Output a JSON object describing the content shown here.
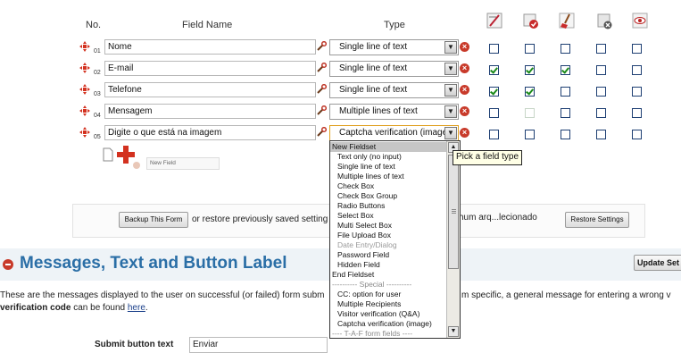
{
  "headers": {
    "no": "No.",
    "field_name": "Field Name",
    "type": "Type"
  },
  "rows": [
    {
      "num": "01",
      "name": "Nome",
      "type": "Single line of text",
      "checks": [
        false,
        false,
        false,
        false,
        false
      ],
      "disabled": [
        false,
        false,
        false,
        false,
        false
      ]
    },
    {
      "num": "02",
      "name": "E-mail",
      "type": "Single line of text",
      "checks": [
        true,
        true,
        true,
        false,
        false
      ],
      "disabled": [
        false,
        false,
        false,
        false,
        false
      ]
    },
    {
      "num": "03",
      "name": "Telefone",
      "type": "Single line of text",
      "checks": [
        true,
        true,
        false,
        false,
        false
      ],
      "disabled": [
        false,
        false,
        false,
        false,
        false
      ]
    },
    {
      "num": "04",
      "name": "Mensagem",
      "type": "Multiple lines of text",
      "checks": [
        false,
        false,
        false,
        false,
        false
      ],
      "disabled": [
        false,
        true,
        false,
        false,
        false
      ]
    },
    {
      "num": "05",
      "name": "Digite o que está na imagem",
      "type": "Captcha verification (image",
      "checks": [
        false,
        false,
        false,
        false,
        false
      ],
      "disabled": [
        false,
        false,
        false,
        false,
        false
      ]
    }
  ],
  "new_field_label": "New Field",
  "backup_button": "Backup This Form",
  "restore_text": "or restore previously saved setting",
  "file_field_text": "hum arq...lecionado",
  "restore_button": "Restore Settings",
  "section_title": "Messages, Text and Button Label",
  "update_button": "Update Set",
  "desc_line1_a": "These are the messages displayed to the user on successful (or failed) form subm",
  "desc_line1_b": "m specific, a general message for entering a wrong v",
  "desc_line2_bold": "verification code",
  "desc_line2_rest": " can be found ",
  "desc_link": "here",
  "desc_line2_end": ".",
  "submit_label": "Submit button text",
  "submit_value": "Enviar",
  "tooltip": "Pick a field type",
  "dropdown_items": [
    {
      "label": "New Fieldset",
      "style": "selected"
    },
    {
      "label": "Text only (no input)",
      "style": "indent"
    },
    {
      "label": "Single line of text",
      "style": "indent"
    },
    {
      "label": "Multiple lines of text",
      "style": "indent"
    },
    {
      "label": "Check Box",
      "style": "indent"
    },
    {
      "label": "Check Box Group",
      "style": "indent"
    },
    {
      "label": "Radio Buttons",
      "style": "indent"
    },
    {
      "label": "Select Box",
      "style": "indent"
    },
    {
      "label": "Multi Select Box",
      "style": "indent"
    },
    {
      "label": "File Upload Box",
      "style": "indent"
    },
    {
      "label": "Date Entry/Dialog",
      "style": "disabled"
    },
    {
      "label": "Password Field",
      "style": "indent"
    },
    {
      "label": "Hidden Field",
      "style": "indent"
    },
    {
      "label": "End Fieldset",
      "style": "plain"
    },
    {
      "label": "---------- Special ----------",
      "style": "group"
    },
    {
      "label": "CC: option for user",
      "style": "indent"
    },
    {
      "label": "Multiple Recipients",
      "style": "indent"
    },
    {
      "label": "Visitor verification (Q&A)",
      "style": "indent"
    },
    {
      "label": "Captcha verification (image)",
      "style": "indent"
    },
    {
      "label": "---- T-A-F form fields ----",
      "style": "group"
    }
  ],
  "colors": {
    "title": "#2a6ea6",
    "accent_red": "#c83a2a",
    "check_green": "#1a8a1a",
    "select_highlight": "#c6c6c6"
  }
}
